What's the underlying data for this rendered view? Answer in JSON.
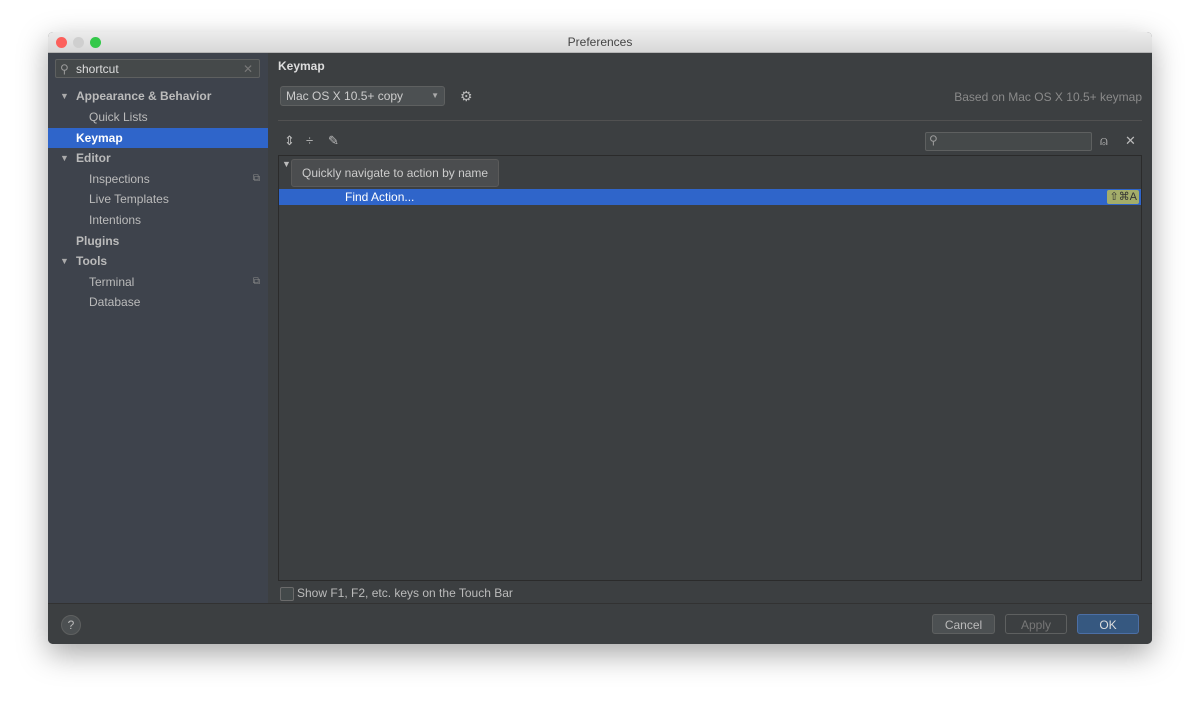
{
  "window": {
    "title": "Preferences"
  },
  "sidebar": {
    "search_value": "shortcut",
    "items": [
      {
        "label": "Appearance & Behavior"
      },
      {
        "label": "Quick Lists"
      },
      {
        "label": "Keymap"
      },
      {
        "label": "Editor"
      },
      {
        "label": "Inspections"
      },
      {
        "label": "Live Templates"
      },
      {
        "label": "Intentions"
      },
      {
        "label": "Plugins"
      },
      {
        "label": "Tools"
      },
      {
        "label": "Terminal"
      },
      {
        "label": "Database"
      }
    ]
  },
  "main": {
    "heading": "Keymap",
    "keymap_select": "Mac OS X 10.5+ copy",
    "based_on": "Based on Mac OS X 10.5+ keymap",
    "tooltip": "Quickly navigate to action by name",
    "row_label": "Find Action...",
    "row_shortcut": "⇧⌘A",
    "touchbar_label": "Show F1, F2, etc. keys on the Touch Bar"
  },
  "footer": {
    "help": "?",
    "cancel": "Cancel",
    "apply": "Apply",
    "ok": "OK"
  },
  "colors": {
    "selection": "#2f65ca",
    "ok": "#365880"
  }
}
